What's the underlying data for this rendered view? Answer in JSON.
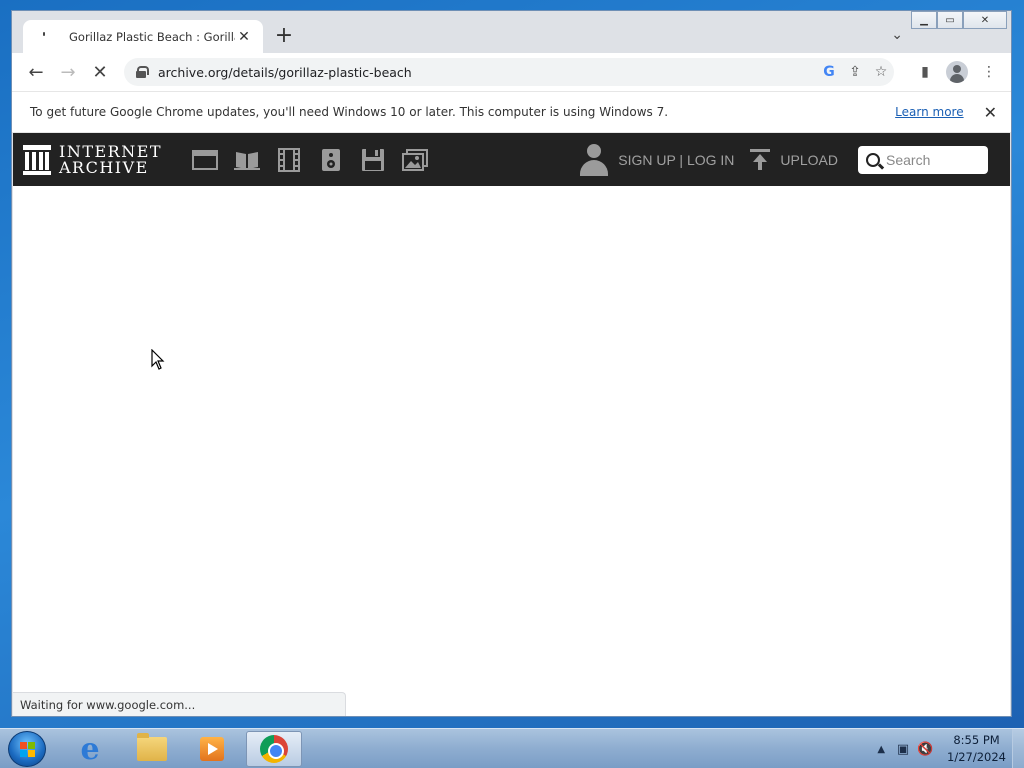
{
  "browser": {
    "tab_title": "Gorillaz Plastic Beach : Gorillaz : F",
    "tab_close": "✕",
    "new_tab": "+",
    "url": "archive.org/details/gorillaz-plastic-beach",
    "status_text": "Waiting for www.google.com..."
  },
  "infobar": {
    "message": "To get future Google Chrome updates, you'll need Windows 10 or later. This computer is using Windows 7.",
    "learn_more": "Learn more",
    "close": "✕"
  },
  "ia_header": {
    "logo_line1": "INTERNET",
    "logo_line2": "ARCHIVE",
    "media_icons": [
      "web-icon",
      "texts-icon",
      "video-icon",
      "audio-icon",
      "software-icon",
      "images-icon"
    ],
    "signup_login": "SIGN UP | LOG IN",
    "upload": "UPLOAD",
    "search_placeholder": "Search"
  },
  "taskbar": {
    "time": "8:55 PM",
    "date": "1/27/2024"
  },
  "colors": {
    "ia_header_bg": "#222222",
    "ia_link": "#a0a0a0",
    "learn_more_link": "#1a5fb4"
  }
}
